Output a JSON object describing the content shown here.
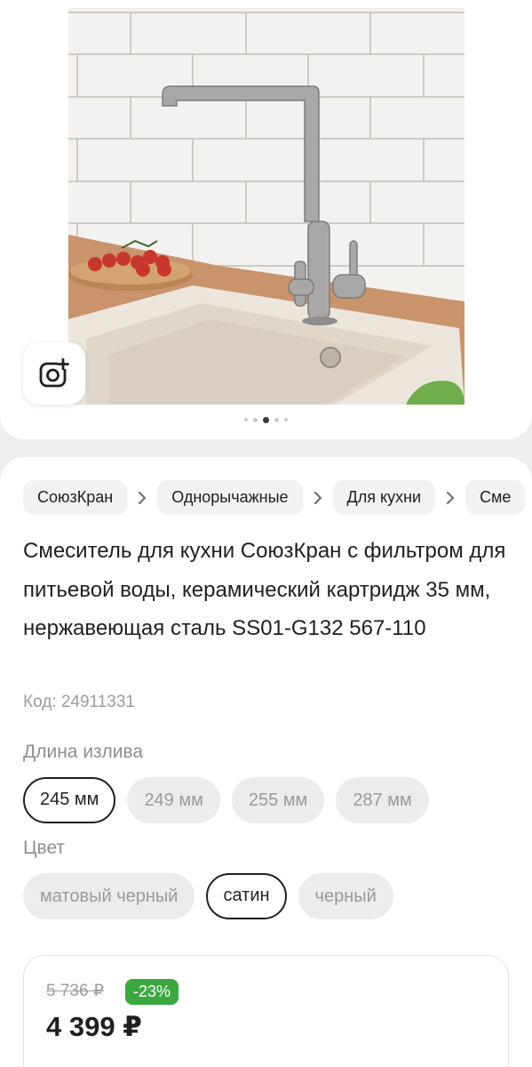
{
  "gallery": {
    "photo_alt": "Смеситель для кухни",
    "visual_search_icon": "camera-plus-icon",
    "dots": {
      "count": 5,
      "active_index": 2
    }
  },
  "breadcrumbs": [
    {
      "label": "СоюзКран"
    },
    {
      "label": "Однорычажные"
    },
    {
      "label": "Для кухни"
    },
    {
      "label": "Сме"
    }
  ],
  "product": {
    "title": "Смеситель для кухни СоюзКран с фильтром для питьевой воды, керамический картридж 35 мм, нержавеющая сталь SS01-G132 567-110",
    "code": "Код: 24911331"
  },
  "spout_length": {
    "label": "Длина излива",
    "options": [
      "245 мм",
      "249 мм",
      "255 мм",
      "287 мм"
    ],
    "selected_index": 0
  },
  "color": {
    "label": "Цвет",
    "options": [
      "матовый черный",
      "сатин",
      "черный"
    ],
    "selected_index": 1
  },
  "price": {
    "old": "5 736 ₽",
    "discount": "-23%",
    "current": "4 399 ₽",
    "discount_color": "#3aa83f"
  }
}
